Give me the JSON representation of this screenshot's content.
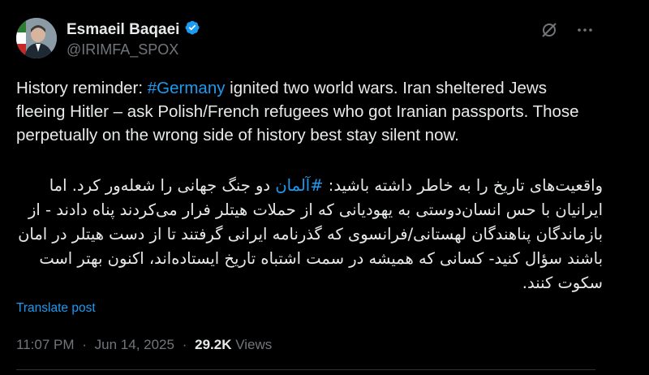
{
  "author": {
    "name": "Esmaeil Baqaei",
    "handle": "@IRIMFA_SPOX",
    "verified_color": "#1d9bf0"
  },
  "icons": {
    "verified": "verified-badge-icon",
    "grok": "grok-icon",
    "more": "more-options-icon"
  },
  "post": {
    "en_part1": "History reminder: ",
    "en_hashtag": "#Germany",
    "en_part2": " ignited two world wars. Iran sheltered Jews fleeing Hitler – ask Polish/French refugees who got Iranian passports. Those perpetually on the wrong side of history best stay silent now.",
    "fa_part1": "واقعیت‌های تاریخ را به خاطر داشته باشید: ",
    "fa_hashtag": "#آلمان",
    "fa_part2": " دو جنگ جهانی را شعله‌ور کرد. اما ایرانیان با حس انسان‌دوستی به یهودیانی که از حملات هیتلر فرار می‌کردند پناه دادند - از بازماندگان پناهندگان لهستانی/فرانسوی که گذرنامه ایرانی گرفتند تا از دست هیتلر در امان باشند سؤال کنید- کسانی که همیشه در سمت اشتباه تاریخ ایستاده‌اند، اکنون بهتر است سکوت کنند."
  },
  "translate_label": "Translate post",
  "meta": {
    "time": "11:07 PM",
    "separator": "·",
    "date": "Jun 14, 2025",
    "views_count": "29.2K",
    "views_label": "Views"
  }
}
